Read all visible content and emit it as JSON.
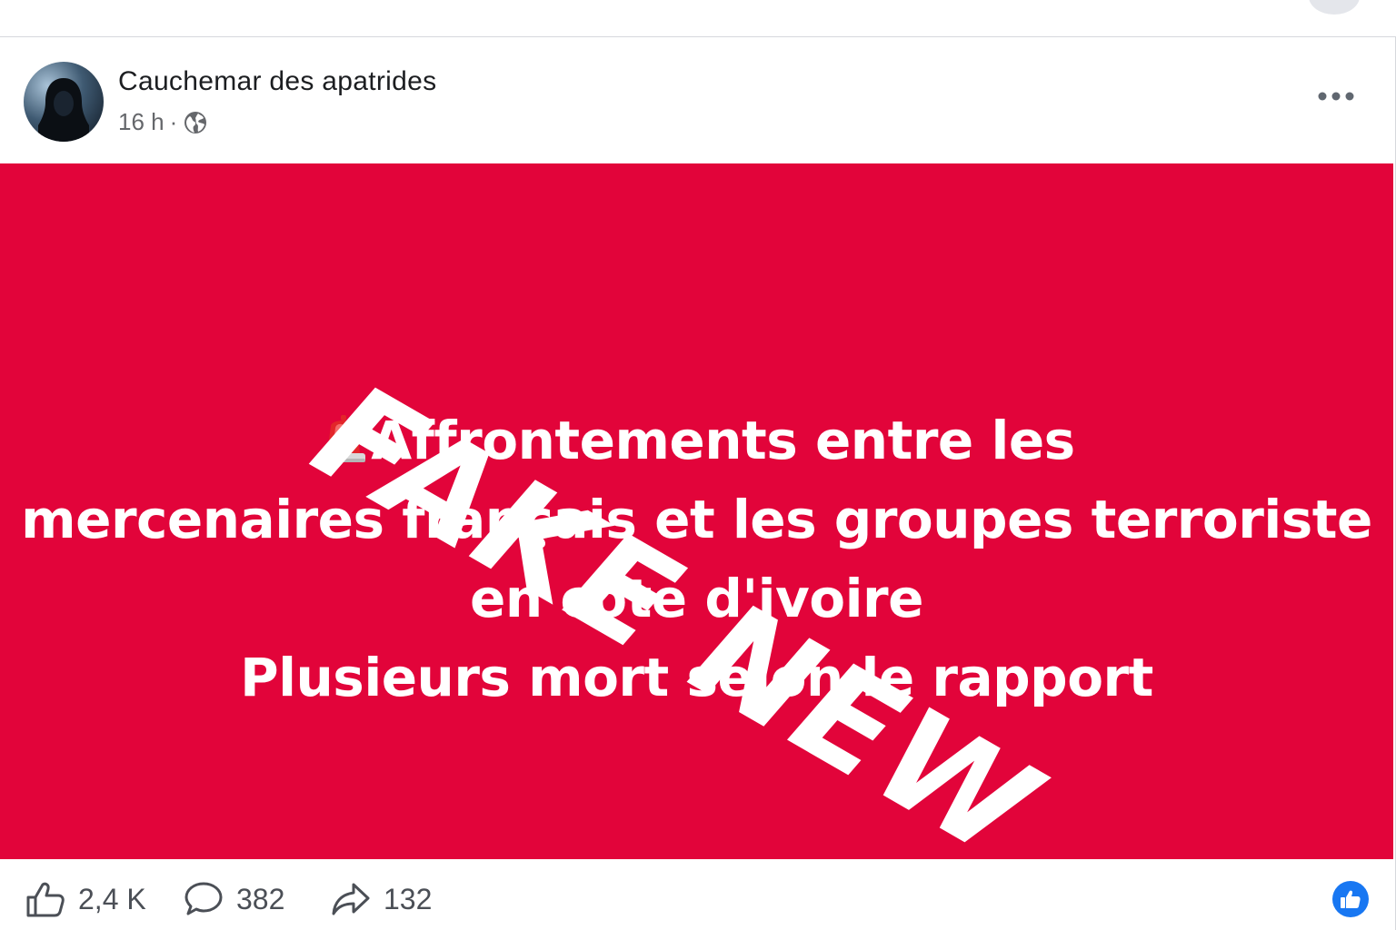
{
  "post": {
    "author": "Cauchemar des apatrides",
    "time": "16 h",
    "separator": "·",
    "image": {
      "stamp": "FAKE NEW",
      "headline_lines": [
        "Affrontements entre les",
        "mercenaires français et les groupes terroriste",
        "en côte d'ivoire",
        "Plusieurs mort selon le rapport"
      ],
      "background_color": "#e2043a"
    },
    "stats": {
      "likes": "2,4 K",
      "comments": "382",
      "shares": "132"
    }
  },
  "icons": {
    "privacy": "globe-icon",
    "menu": "more-options-icon",
    "like": "thumbs-up-icon",
    "comment": "comment-bubble-icon",
    "share": "share-arrow-icon",
    "reaction": "like-reaction-icon",
    "alert": "police-siren-icon"
  },
  "colors": {
    "accent": "#1877f2",
    "text_primary": "#1c1e21",
    "text_secondary": "#65676b"
  }
}
